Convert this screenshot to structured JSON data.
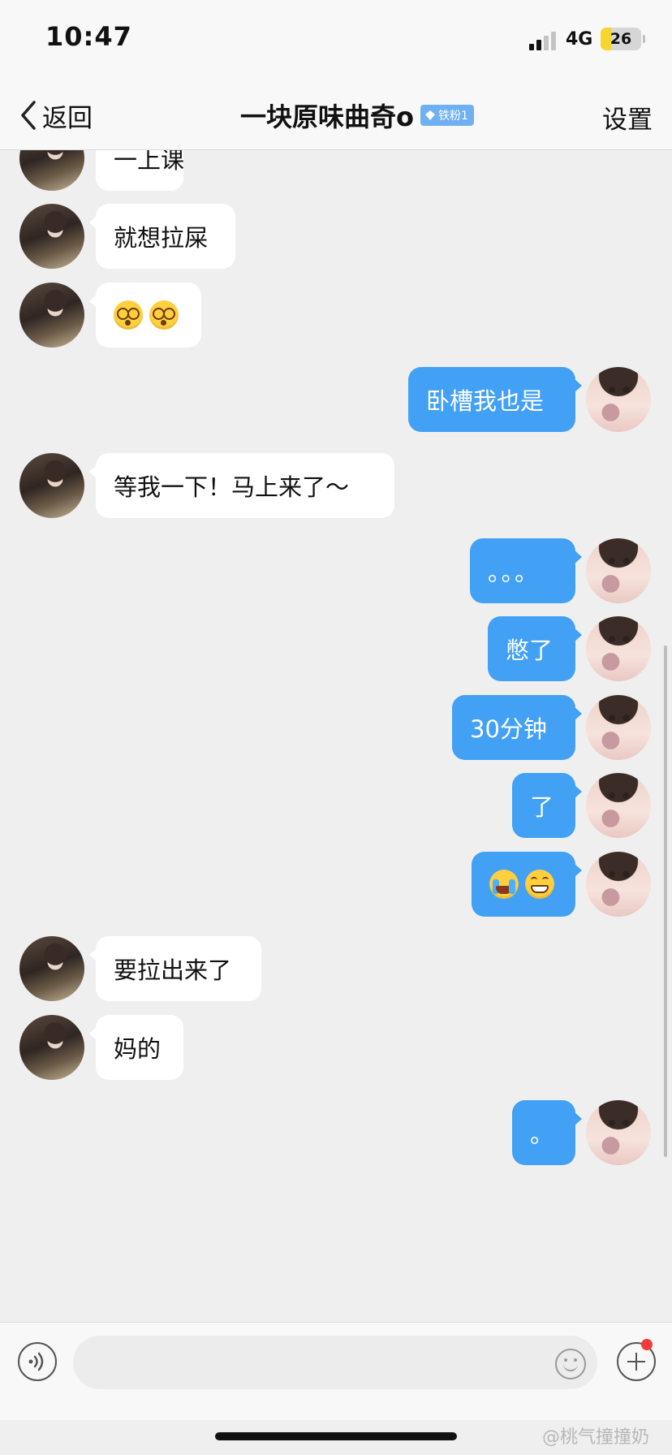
{
  "status_bar": {
    "time": "10:47",
    "network": "4G",
    "battery": "26"
  },
  "nav": {
    "back_label": "返回",
    "title": "一块原味曲奇o",
    "badge": "铁粉1",
    "settings_label": "设置"
  },
  "messages": [
    {
      "side": "left",
      "text": "一上课",
      "top": 0
    },
    {
      "side": "left",
      "text": "就想拉屎",
      "top": 0
    },
    {
      "side": "left",
      "text": "",
      "emoji": [
        "dizzy-emoji",
        "dizzy-emoji"
      ]
    },
    {
      "side": "right",
      "text": "卧槽我也是"
    },
    {
      "side": "left",
      "text": "等我一下！马上来了～"
    },
    {
      "side": "right",
      "text": "。。。"
    },
    {
      "side": "right",
      "text": "憋了"
    },
    {
      "side": "right",
      "text": "30分钟"
    },
    {
      "side": "right",
      "text": "了"
    },
    {
      "side": "right",
      "text": "",
      "emoji": [
        "crying-emoji",
        "grinning-emoji"
      ]
    },
    {
      "side": "left",
      "text": "要拉出来了"
    },
    {
      "side": "left",
      "text": "妈的"
    },
    {
      "side": "right",
      "text": "。"
    }
  ],
  "input": {
    "placeholder": ""
  },
  "watermark": "@桃气撞撞奶",
  "colors": {
    "my_bubble": "#42a1f5",
    "their_bubble": "#ffffff",
    "background": "#efefef",
    "badge": "#6fb1f0"
  }
}
